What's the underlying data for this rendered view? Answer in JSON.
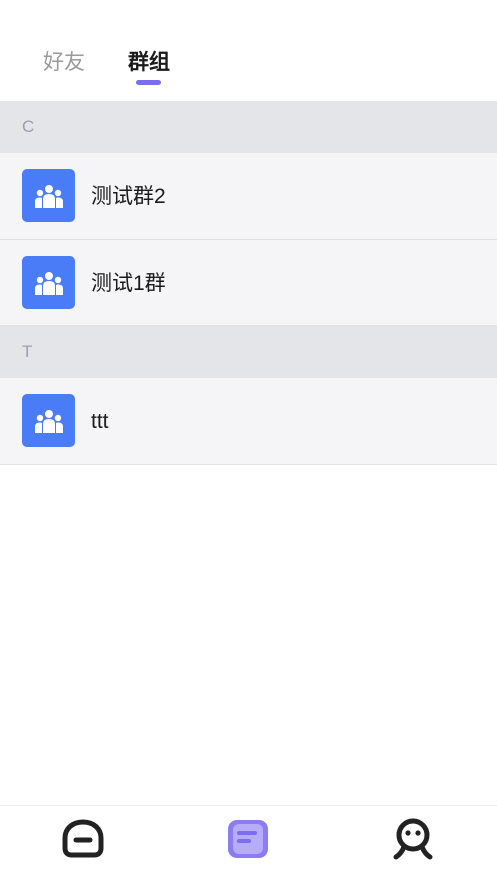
{
  "tabs": {
    "friends": "好友",
    "groups": "群组",
    "active": "groups"
  },
  "sections": [
    {
      "letter": "C",
      "groups": [
        {
          "name": "测试群2"
        },
        {
          "name": "测试1群"
        }
      ]
    },
    {
      "letter": "T",
      "groups": [
        {
          "name": "ttt"
        }
      ]
    }
  ],
  "bottom_nav": {
    "items": [
      {
        "icon": "home-icon",
        "active": false
      },
      {
        "icon": "messages-icon",
        "active": true
      },
      {
        "icon": "profile-icon",
        "active": false
      }
    ]
  },
  "colors": {
    "accent": "#7b6cf0",
    "avatar_bg": "#4a7cf7",
    "section_bg": "#e4e5e9",
    "row_bg": "#f5f5f8"
  }
}
